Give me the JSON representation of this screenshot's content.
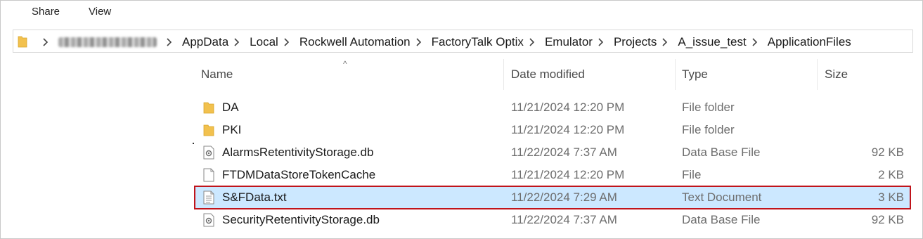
{
  "ribbon": {
    "tabs": [
      "Share",
      "View"
    ]
  },
  "address": {
    "crumbs": [
      "AppData",
      "Local",
      "Rockwell Automation",
      "FactoryTalk Optix",
      "Emulator",
      "Projects",
      "A_issue_test",
      "ApplicationFiles"
    ]
  },
  "list": {
    "headers": {
      "name": "Name",
      "date": "Date modified",
      "type": "Type",
      "size": "Size"
    },
    "rows": [
      {
        "name": "DA",
        "date": "11/21/2024 12:20 PM",
        "type": "File folder",
        "size": "",
        "icon": "folder-icon"
      },
      {
        "name": "PKI",
        "date": "11/21/2024 12:20 PM",
        "type": "File folder",
        "size": "",
        "icon": "folder-icon"
      },
      {
        "name": "AlarmsRetentivityStorage.db",
        "date": "11/22/2024 7:37 AM",
        "type": "Data Base File",
        "size": "92 KB",
        "icon": "db-file-icon"
      },
      {
        "name": "FTDMDataStoreTokenCache",
        "date": "11/21/2024 12:20 PM",
        "type": "File",
        "size": "2 KB",
        "icon": "blank-file-icon"
      },
      {
        "name": "S&FData.txt",
        "date": "11/22/2024 7:29 AM",
        "type": "Text Document",
        "size": "3 KB",
        "icon": "text-file-icon",
        "selected": true
      },
      {
        "name": "SecurityRetentivityStorage.db",
        "date": "11/22/2024 7:37 AM",
        "type": "Data Base File",
        "size": "92 KB",
        "icon": "db-file-icon"
      }
    ]
  },
  "colors": {
    "selection": "#cce8ff",
    "highlight_border": "#c0141b",
    "folder": "#f2c14e"
  }
}
